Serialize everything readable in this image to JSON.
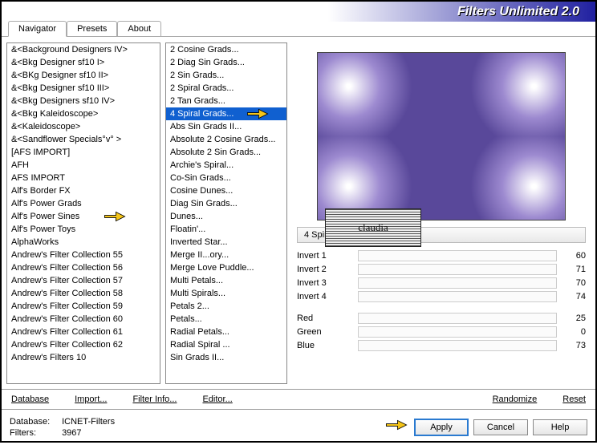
{
  "header": {
    "title": "Filters Unlimited 2.0"
  },
  "tabs": [
    {
      "label": "Navigator",
      "active": true
    },
    {
      "label": "Presets",
      "active": false
    },
    {
      "label": "About",
      "active": false
    }
  ],
  "categories": [
    "&<Background Designers IV>",
    "&<Bkg Designer sf10 I>",
    "&<BKg Designer sf10 II>",
    "&<Bkg Designer sf10 III>",
    "&<Bkg Designers sf10 IV>",
    "&<Bkg Kaleidoscope>",
    "&<Kaleidoscope>",
    "&<Sandflower Specials°v° >",
    "[AFS IMPORT]",
    "AFH",
    "AFS IMPORT",
    "Alf's Border FX",
    "Alf's Power Grads",
    "Alf's Power Sines",
    "Alf's Power Toys",
    "AlphaWorks",
    "Andrew's Filter Collection 55",
    "Andrew's Filter Collection 56",
    "Andrew's Filter Collection 57",
    "Andrew's Filter Collection 58",
    "Andrew's Filter Collection 59",
    "Andrew's Filter Collection 60",
    "Andrew's Filter Collection 61",
    "Andrew's Filter Collection 62",
    "Andrew's Filters 10"
  ],
  "category_pointer_at": "Alf's Power Sines",
  "filters": [
    "2 Cosine Grads...",
    "2 Diag Sin Grads...",
    "2 Sin Grads...",
    "2 Spiral Grads...",
    "2 Tan Grads...",
    "4 Spiral Grads...",
    "Abs Sin Grads II...",
    "Absolute 2 Cosine Grads...",
    "Absolute 2 Sin Grads...",
    "Archie's Spiral...",
    "Co-Sin Grads...",
    "Cosine Dunes...",
    "Diag Sin Grads...",
    "Dunes...",
    "Floatin'...",
    "Inverted Star...",
    "Merge II...ory...",
    "Merge Love Puddle...",
    "Multi Petals...",
    "Multi Spirals...",
    "Petals 2...",
    "Petals...",
    "Radial Petals...",
    "Radial Spiral ...",
    "Sin Grads II..."
  ],
  "filter_selected": "4 Spiral Grads...",
  "selected_filter_label": "4 Spiral Grads...",
  "params_a": [
    {
      "label": "Invert 1",
      "value": 60
    },
    {
      "label": "Invert 2",
      "value": 71
    },
    {
      "label": "Invert 3",
      "value": 70
    },
    {
      "label": "Invert 4",
      "value": 74
    }
  ],
  "params_b": [
    {
      "label": "Red",
      "value": 25
    },
    {
      "label": "Green",
      "value": 0
    },
    {
      "label": "Blue",
      "value": 73
    }
  ],
  "bottom_links": {
    "database": "Database",
    "import": "Import...",
    "filter_info": "Filter Info...",
    "editor": "Editor...",
    "randomize": "Randomize",
    "reset": "Reset"
  },
  "footer": {
    "db_label": "Database:",
    "db_value": "ICNET-Filters",
    "filters_label": "Filters:",
    "filters_value": "3967"
  },
  "buttons": {
    "apply": "Apply",
    "cancel": "Cancel",
    "help": "Help"
  },
  "watermark": "claudia"
}
